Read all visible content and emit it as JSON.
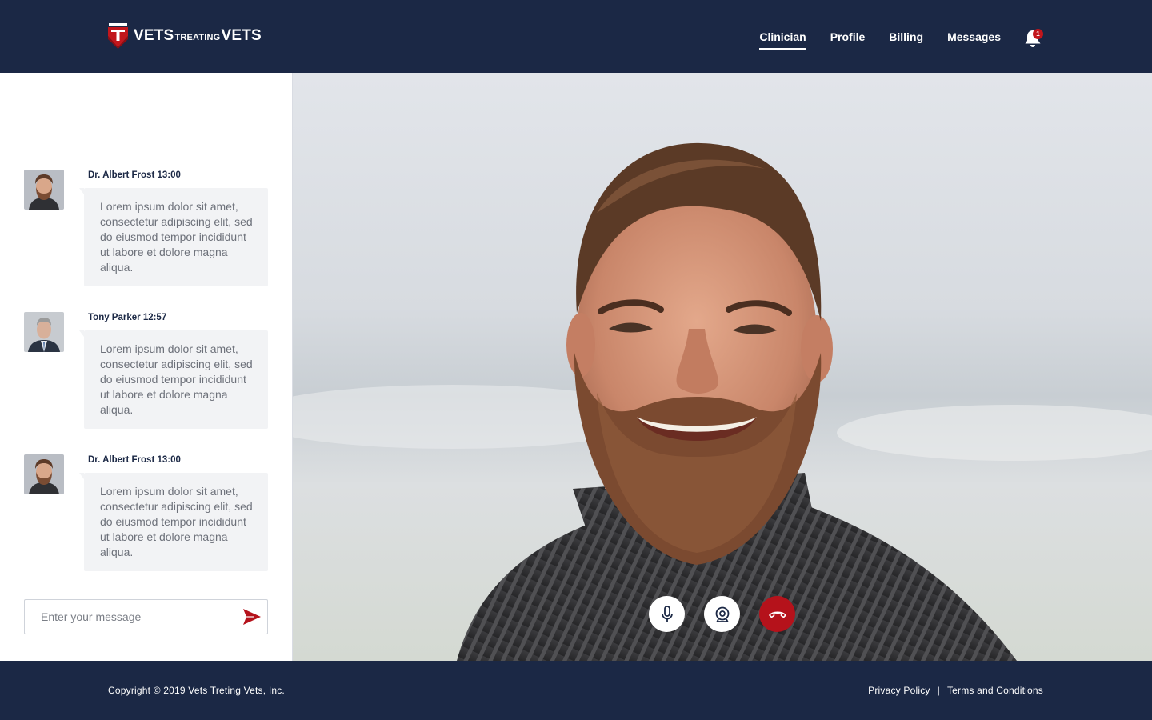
{
  "brand": {
    "logo_part1": "VETS",
    "logo_part2": "TREATING",
    "logo_part3": "VETS",
    "primary_color": "#1b2845",
    "accent_color": "#b5121b"
  },
  "nav": {
    "items": [
      {
        "label": "Clinician",
        "active": true
      },
      {
        "label": "Profile",
        "active": false
      },
      {
        "label": "Billing",
        "active": false
      },
      {
        "label": "Messages",
        "active": false
      }
    ],
    "notifications": {
      "count": "1",
      "icon": "bell-icon"
    }
  },
  "chat": {
    "messages": [
      {
        "author": "Dr. Albert Frost 13:00",
        "text": "Lorem ipsum dolor sit amet, consectetur adipiscing elit, sed do eiusmod tempor incididunt ut labore et dolore magna aliqua."
      },
      {
        "author": "Tony Parker 12:57",
        "text": "Lorem ipsum dolor sit amet, consectetur adipiscing elit, sed do eiusmod tempor incididunt ut labore et dolore magna aliqua."
      },
      {
        "author": "Dr. Albert Frost 13:00",
        "text": "Lorem ipsum dolor sit amet, consectetur adipiscing elit, sed do eiusmod tempor incididunt ut labore et dolore magna aliqua."
      }
    ],
    "composer": {
      "placeholder": "Enter your message",
      "value": "",
      "send_icon": "send-icon"
    }
  },
  "video": {
    "controls": [
      {
        "icon": "microphone-icon"
      },
      {
        "icon": "webcam-icon"
      },
      {
        "icon": "end-call-icon"
      }
    ]
  },
  "footer": {
    "copyright": "Copyright © 2019 Vets Treting Vets, Inc.",
    "privacy": "Privacy Policy",
    "separator": "|",
    "terms": "Terms and Conditions"
  }
}
